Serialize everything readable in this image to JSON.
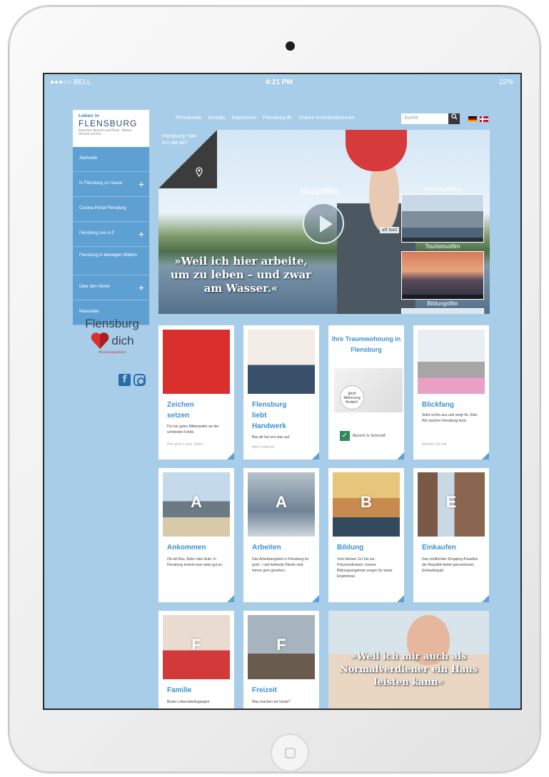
{
  "statusbar": {
    "carrier": "●●●○○ BELL",
    "time": "4:21 PM",
    "battery": "22%"
  },
  "logo": {
    "small": "Leben in",
    "big": "FLENSBURG",
    "tag": "Zwischen Himmel und Förde · Weiten Himmel auf Erd"
  },
  "sidebar": {
    "items": [
      {
        "label": "Startseite",
        "has_plus": false
      },
      {
        "label": "In Flensburg zu Hause",
        "has_plus": true
      },
      {
        "label": "Corona-Portal Flensburg",
        "has_plus": false
      },
      {
        "label": "Flensburg von A-Z",
        "has_plus": true
      },
      {
        "label": "Flensburg in bewegten Bildern",
        "has_plus": false
      },
      {
        "label": "Über den Verein",
        "has_plus": true
      },
      {
        "label": "Newsletter",
        "has_plus": false
      }
    ]
  },
  "brand_logo": {
    "line1": "Flensburg",
    "line2": "dich",
    "sub": "#flensburgliebtdich"
  },
  "social": {
    "facebook": "f",
    "instagram": ""
  },
  "topnav": {
    "items": [
      "Presseseite",
      "Kontakt",
      "Impressum",
      "Flensburg.de",
      "Unsere Entscheiderinnen"
    ]
  },
  "search": {
    "placeholder": "Suche",
    "button": "🔍"
  },
  "hero": {
    "corner_text": "Flensburg? Wie is'n dat da?",
    "label": "Hauptfilm",
    "alt_tag": "alt text",
    "quote": "»Weil ich hier arbeite, um zu leben – und zwar am Wasser.«",
    "thumbs": [
      {
        "label": "Wirtschaftsfilm"
      },
      {
        "label": "Tourismusfilm"
      },
      {
        "label": "Bildungsfilm"
      }
    ]
  },
  "cards": {
    "c1": {
      "title": "Zeichen setzen",
      "text": "Für ein gutes Miteinander an der schönsten Förde.",
      "more": "Hier geht´s zum Video!"
    },
    "c2": {
      "title": "Flensburg liebt Handwerk",
      "text": "Bau dir bei uns was auf.",
      "more": "Mehr erfahren"
    },
    "c3": {
      "title": "Ihre Traumwohnung in Flensburg",
      "sign": "Jetzt Wohnung finden!",
      "firm": "Bensch & Schmidt"
    },
    "c4": {
      "title": "Blickfang",
      "text": "Sieht schön aus und sorgt für Jobs: Wir machen Flensburg bunt.",
      "more": "Machen Sie mit"
    },
    "c5": {
      "letter": "A",
      "title": "Ankommen",
      "text": "Ob mit Bus, Bahn oder Auto: In Flensburg kommt man stets gut an."
    },
    "c6": {
      "letter": "A",
      "title": "Arbeiten",
      "text": "Das Arbeitsangebot in Flensburg ist groß – und helfende Hände sind immer gern gesehen."
    },
    "c7": {
      "letter": "B",
      "title": "Bildung",
      "text": "Vom kleinen 1x1 bis zur Polynomdivision: Unsere Bildungsangebote sorgen für beste Ergebnisse."
    },
    "c8": {
      "letter": "E",
      "title": "Einkaufen",
      "text": "Das nördlichste Shopping-Paradies der Republik bietet grenzenlosen Einkaufsspaß."
    },
    "c9": {
      "letter": "F",
      "title": "Familie",
      "text": "Beste Lebensbedingungen"
    },
    "c10": {
      "letter": "F",
      "title": "Freizeit",
      "text": "Was machen wir heute?"
    },
    "c11": {
      "quote": "»Weil ich mir auch als Normalverdiener ein Haus leisten kann«"
    }
  },
  "colors": {
    "background": "#a7cde9",
    "nav_blue": "#5fa0d3",
    "title_blue": "#3d92d0",
    "accent_red": "#d9302e"
  }
}
